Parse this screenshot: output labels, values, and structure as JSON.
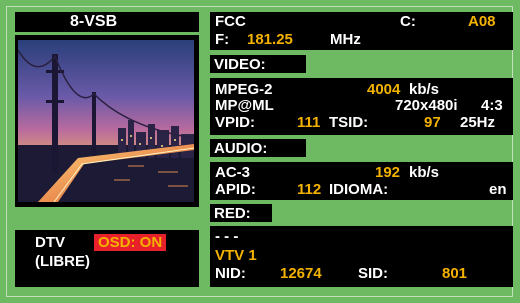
{
  "modulation": "8-VSB",
  "freq_block": {
    "standard": "FCC",
    "channel_label": "C:",
    "channel_value": "A08",
    "freq_label": "F:",
    "freq_value": "181.25",
    "freq_unit": "MHz"
  },
  "video": {
    "header": "VIDEO:",
    "codec": "MPEG-2",
    "bitrate": "4004",
    "bitrate_unit": "kb/s",
    "profile": "MP@ML",
    "resolution": "720x480i",
    "aspect": "4:3",
    "vpid_label": "VPID:",
    "vpid": "111",
    "tsid_label": "TSID:",
    "tsid": "97",
    "framerate": "25Hz"
  },
  "audio": {
    "header": "AUDIO:",
    "codec": "AC-3",
    "bitrate": "192",
    "bitrate_unit": "kb/s",
    "apid_label": "APID:",
    "apid": "112",
    "language_label": "IDIOMA:",
    "language": "en"
  },
  "network": {
    "header": "RED:",
    "dashes": "- - -",
    "service_name": "VTV 1",
    "nid_label": "NID:",
    "nid": "12674",
    "sid_label": "SID:",
    "sid": "801"
  },
  "status": {
    "mode": "DTV",
    "osd": "OSD: ON",
    "access": "(LIBRE)"
  },
  "preview": {
    "subject": "bridge-at-night-image"
  }
}
